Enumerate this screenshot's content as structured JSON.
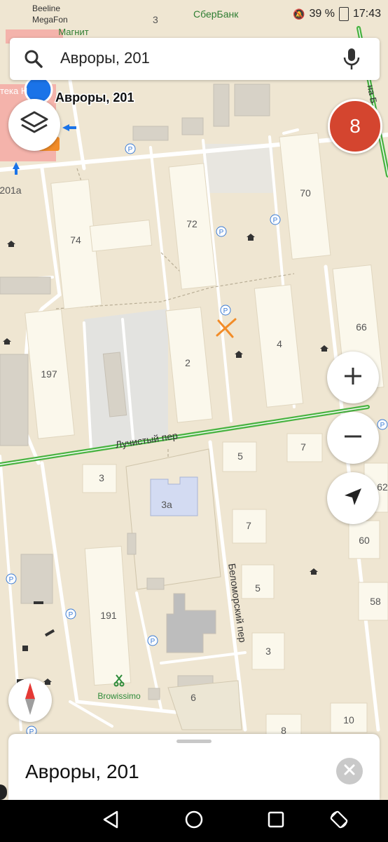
{
  "status": {
    "operator1": "Beeline",
    "operator2": "MegaFon",
    "top_number": "3",
    "center_label": "СберБанк",
    "battery": "39 %",
    "time": "17:43"
  },
  "search": {
    "query": "Авроры, 201",
    "search_icon": "search-icon",
    "mic_icon": "microphone-icon"
  },
  "map": {
    "poi_labels": {
      "magnit": "Магнит",
      "pharmacy": "тека Н",
      "pin_label": "Авроры, 201",
      "browissimo": "Browissimo"
    },
    "house_numbers": {
      "h201a": "201а",
      "h74": "74",
      "h72": "72",
      "h70": "70",
      "h197": "197",
      "h2": "2",
      "h4": "4",
      "h66": "66",
      "h5": "5",
      "h7a": "7",
      "h3a": "3",
      "h3b": "3а",
      "h62": "62",
      "h7b": "7",
      "h60": "60",
      "h5b": "5",
      "h58": "58",
      "h191": "191",
      "h3c": "3",
      "h6": "6",
      "h8": "8",
      "h10": "10"
    },
    "streets": {
      "luchisty": "Лучистый пер",
      "belomorsky": "Беломорский пер",
      "right_street": "на Б"
    },
    "colors": {
      "background": "#efe6d2",
      "building": "#f9f5e8",
      "road": "#ffffff",
      "route": "#49b342",
      "pin": "#1a73e8"
    }
  },
  "controls": {
    "layers_icon": "layers-icon",
    "badge_count": "8",
    "zoom_in_icon": "plus-icon",
    "zoom_out_icon": "minus-icon",
    "locate_icon": "navigation-arrow-icon",
    "compass_icon": "compass-icon"
  },
  "card": {
    "title": "Авроры, 201",
    "close_icon": "close-icon"
  },
  "navbar": {
    "back_icon": "back-triangle-icon",
    "home_icon": "home-circle-icon",
    "recent_icon": "recent-square-icon",
    "rotate_icon": "rotate-icon"
  }
}
